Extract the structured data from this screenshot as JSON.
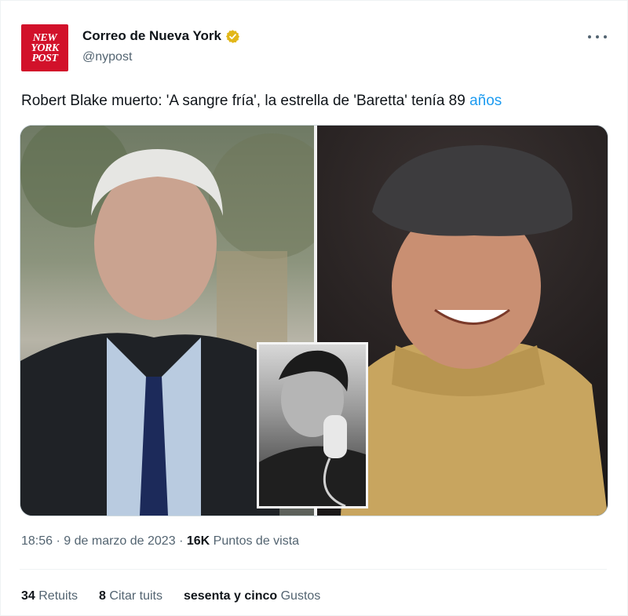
{
  "account": {
    "logo_lines": [
      "NEW",
      "YORK",
      "POST"
    ],
    "display_name": "Correo de Nueva York",
    "handle": "@nypost",
    "verified_icon": "gold-verified-badge-icon",
    "more_icon": "more-options-icon"
  },
  "tweet": {
    "text": "Robert Blake muerto: 'A sangre fría', la estrella de 'Baretta' tenía 89 ",
    "link_text": "años"
  },
  "meta": {
    "time": "18:56",
    "date": "9 de marzo de 2023",
    "dot": "·",
    "views_count": "16K",
    "views_label": "Puntos de vista"
  },
  "stats": {
    "retweets_count": "34",
    "retweets_label": "Retuits",
    "quotes_count": "8",
    "quotes_label": "Citar tuits",
    "likes_count": "sesenta y cinco",
    "likes_label": "Gustos"
  },
  "colors": {
    "accent": "#1d9bf0",
    "brand": "#d2112a",
    "verified": "#e2b719"
  }
}
